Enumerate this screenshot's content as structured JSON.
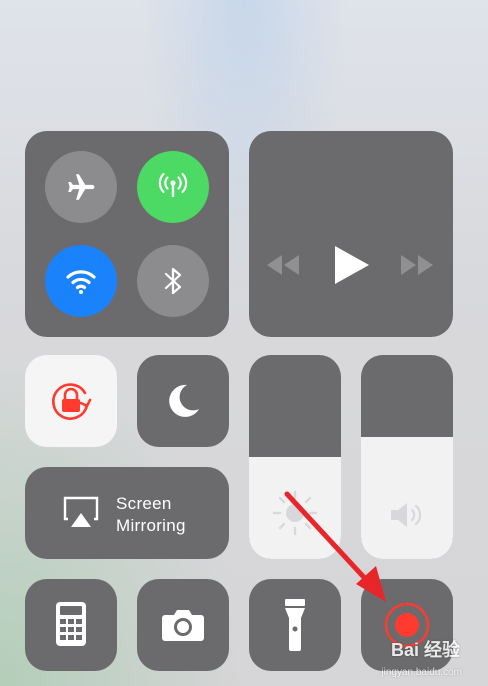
{
  "connectivity": {
    "airplane": {
      "icon": "airplane-icon",
      "active": false
    },
    "cellular": {
      "icon": "cellular-antenna-icon",
      "active": true,
      "color": "#4cd964"
    },
    "wifi": {
      "icon": "wifi-icon",
      "active": true,
      "color": "#1a82fb"
    },
    "bluetooth": {
      "icon": "bluetooth-icon",
      "active": false
    }
  },
  "media": {
    "rewind_icon": "rewind-icon",
    "play_icon": "play-icon",
    "forward_icon": "fast-forward-icon"
  },
  "toggles": {
    "rotation_lock": {
      "icon": "rotation-lock-icon",
      "active": true,
      "color": "#ff3b30"
    },
    "do_not_disturb": {
      "icon": "moon-icon",
      "active": false
    }
  },
  "screen_mirroring": {
    "line1": "Screen",
    "line2": "Mirroring",
    "icon": "airplay-icon"
  },
  "brightness": {
    "level": 0.5,
    "icon": "sun-icon"
  },
  "volume": {
    "level": 0.6,
    "icon": "speaker-icon"
  },
  "shortcuts": [
    {
      "name": "calculator",
      "icon": "calculator-icon"
    },
    {
      "name": "camera",
      "icon": "camera-icon"
    },
    {
      "name": "flashlight",
      "icon": "flashlight-icon"
    },
    {
      "name": "screen-recording",
      "icon": "record-icon",
      "color": "#ff3b30"
    }
  ],
  "annotation": {
    "arrow_color": "#e8262a"
  },
  "watermark": {
    "brand": "Bai 经验",
    "url": "jingyan.baidu.com"
  }
}
